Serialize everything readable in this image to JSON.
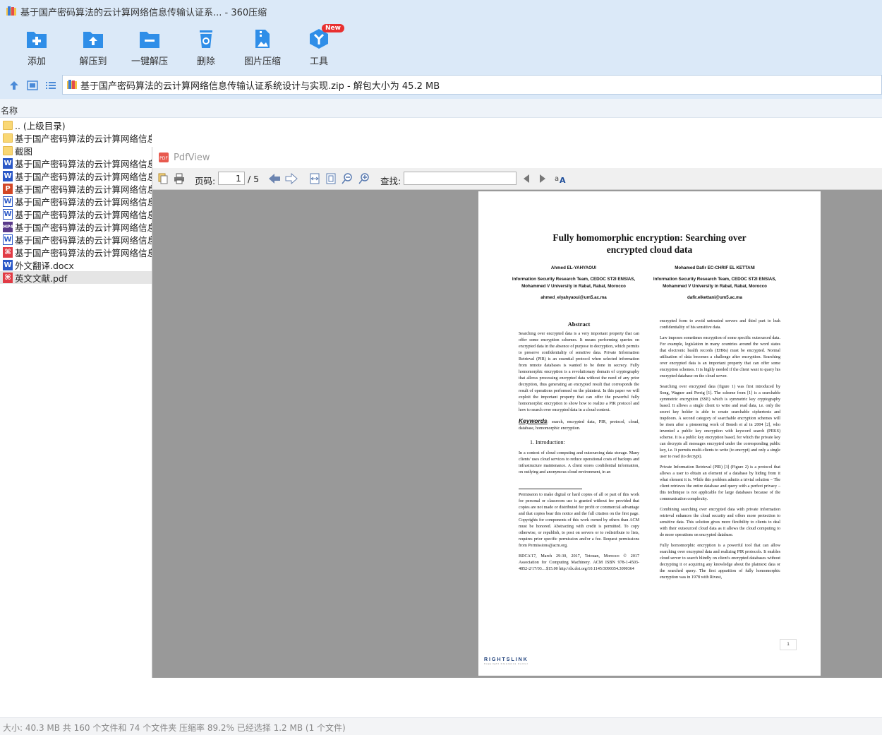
{
  "window": {
    "title": "基于国产密码算法的云计算网络信息传输认证系... - 360压缩"
  },
  "toolbar": [
    {
      "label": "添加",
      "icon": "add-icon"
    },
    {
      "label": "解压到",
      "icon": "extract-to-icon"
    },
    {
      "label": "一键解压",
      "icon": "one-click-extract-icon"
    },
    {
      "label": "删除",
      "icon": "delete-icon"
    },
    {
      "label": "图片压缩",
      "icon": "image-compress-icon"
    },
    {
      "label": "工具",
      "icon": "tools-icon",
      "badge": "New"
    }
  ],
  "address": {
    "text": "基于国产密码算法的云计算网络信息传输认证系统设计与实现.zip - 解包大小为 45.2 MB"
  },
  "list": {
    "column_name": "名称",
    "files": [
      {
        "name": ".. (上级目录)",
        "type": "folder"
      },
      {
        "name": "基于国产密码算法的云计算网络信息传输认证系统设计与实现 客户端服务端源码",
        "type": "folder"
      },
      {
        "name": "截图",
        "type": "folder"
      },
      {
        "name": "基于国产密码算法的云计算网络信息传输认证系统设计与实现",
        "type": "word"
      },
      {
        "name": "基于国产密码算法的云计算网络信息传输认证系统设计与实现",
        "type": "word"
      },
      {
        "name": "基于国产密码算法的云计算网络信息传输认证系统设计与实现",
        "type": "ppt"
      },
      {
        "name": "基于国产密码算法的云计算网络信息传输认证系统设计与实现",
        "type": "wordo"
      },
      {
        "name": "基于国产密码算法的云计算网络信息传输认证系统设计与实现",
        "type": "wordo"
      },
      {
        "name": "基于国产密码算法的云计算网络信息传输认证系统设计与实现",
        "type": "mp4"
      },
      {
        "name": "基于国产密码算法的云计算网络信息传输认证系统设计与实现",
        "type": "wordo"
      },
      {
        "name": "基于国产密码算法的云计算网络信息传输认证系统设计与实现",
        "type": "pdf"
      },
      {
        "name": "外文翻译.docx",
        "type": "word"
      },
      {
        "name": "英文文献.pdf",
        "type": "pdf",
        "selected": true
      }
    ]
  },
  "status": {
    "text": "大小: 40.3 MB 共 160 个文件和 74 个文件夹 压缩率 89.2% 已经选择 1.2 MB (1 个文件)"
  },
  "pdfview": {
    "title": "PdfView",
    "page_label": "页码:",
    "page_current": "1",
    "page_total": "/ 5",
    "find_label": "查找:",
    "doc": {
      "title_line1": "Fully homomorphic encryption: Searching over",
      "title_line2": "encrypted cloud data",
      "author1": {
        "name": "Ahmed EL-YAHYAOUI",
        "affil1": "Information Security Research Team, CEDOC ST2I ENSIAS,",
        "affil2": "Mohammed V University in Rabat, Rabat, Morocco",
        "email": "ahmed_elyahyaoui@um5.ac.ma"
      },
      "author2": {
        "name": "Mohamed Dafir EC-CHRIF EL KETTANI",
        "affil1": "Information Security Research Team, CEDOC ST2I ENSIAS,",
        "affil2": "Mohammed V University in Rabat, Rabat, Morocco",
        "email": "dafir.elkettani@um5.ac.ma"
      },
      "abstract_heading": "Abstract",
      "abstract": "Searching over encrypted data is a very important property that can offer some encryption schemes. It means performing queries on encrypted data in the absence of purpose to decryption, which permits to preserve confidentiality of sensitive data. Private Information Retrieval (PIR) is an essential protocol when selected information from remote databases is wanted to be done in secrecy. Fully homomorphic encryption is a revolutionary domain of cryptography that allows processing encrypted data without the need of any prior decryption, thus generating an encrypted result that corresponds the result of operations performed on the plaintext. In this paper we will exploit the important property that can offer the powerful fully homomorphic encryption to show how to realize a PIR protocol and how to search over encrypted data in a cloud context.",
      "keywords_label": "Keywords",
      "keywords": ": search, encrypted data, PIR, protocol, cloud, database, homomorphic encryption.",
      "intro_heading": "1.    Introduction:",
      "intro": "In a context of cloud computing and outsourcing data storage. Many clients' uses cloud services to reduce operational costs of backups and infrastructure maintenance. A client stores confidential information, on outlying and anonymous cloud environment, in an",
      "footnote": "Permission to make digital or hard copies of all or part of this work for personal or classroom use is granted without fee provided that copies are not made or distributed for profit or commercial advantage and that copies bear this notice and the full citation on the first page. Copyrights for components of this work owned by others than ACM must be honored. Abstracting with credit is permitted. To copy otherwise, or republish, to post on servers or to redistribute to lists, requires prior specific permission and/or a fee. Request permissions from Permissions@acm.org.",
      "citation": "BDCA'17, March 29-30, 2017, Tetouan, Morocco © 2017 Association for Computing Machinery. ACM ISBN 978-1-4503-4852-2/17/03…$15.00 http://dx.doi.org/10.1145/3090354.3090364",
      "right_col": [
        "encrypted form to avoid untrusted servers and third part to leak confidentiality of his sensitive data.",
        "Law imposes sometimes encryption of some specific outsourced data. For example, legislation in many countries around the word states that electronic health records (EHRs) must be encrypted. Normal utilization of data becomes a challenge after encryption. Searching over encrypted data is an important property that can offer some encryption schemes. It is highly needed if the client want to query his encrypted database on the cloud server.",
        "Searching over encrypted data (figure 1) was first introduced by Song, Wagner and Perrig [1]. The scheme from [1] is a searchable symmetric encryption (SSE) which is symmetric key cryptography based. It allows a single client to write and read data, i.e. only the secret key holder is able to create searchable ciphertexts and trapdoors. A second category of searchable encryption schemes will be risen after a pioneering work of Boneh et al in 2004 [2], who invented a public key encryption with keyword search (PEKS) scheme. It is a public key encryption based, for which the private key can decrypts all messages encrypted under the corresponding public key, i.e. It permits multi-clients to write (to encrypt) and only a single user to read (to decrypt).",
        "Private Information Retrieval (PIR) [3] (Figure 2) is a protocol that allows a user to obtain an element of a database by hiding from it what element it is. While this problem admits a trivial solution – The client retrieves the entire database and query with a perfect privacy – this technique is not applicable for large databases because of the communication complexity.",
        "Combining searching over encrypted data with private information retrieval enhances the cloud security and offers more protection to sensitive data. This solution gives more flexibility to clients to deal with their outsourced cloud data as it allows the cloud computing to do more operations on encrypted database.",
        "Fully homomorphic encryption is a powerful tool that can allow searching over encrypted data and realizing PIR protocols. It enables cloud server to search blindly on client's encrypted databases without decrypting it or acquiring any knowledge about the plaintext data or the searched query. The first apparition of fully homomorphic encryption was in 1978 with Rivest,"
      ],
      "page_number": "1",
      "rightslink": "RIGHTSLINK",
      "rightslink_sub": "Copyright Clearance Center"
    }
  }
}
